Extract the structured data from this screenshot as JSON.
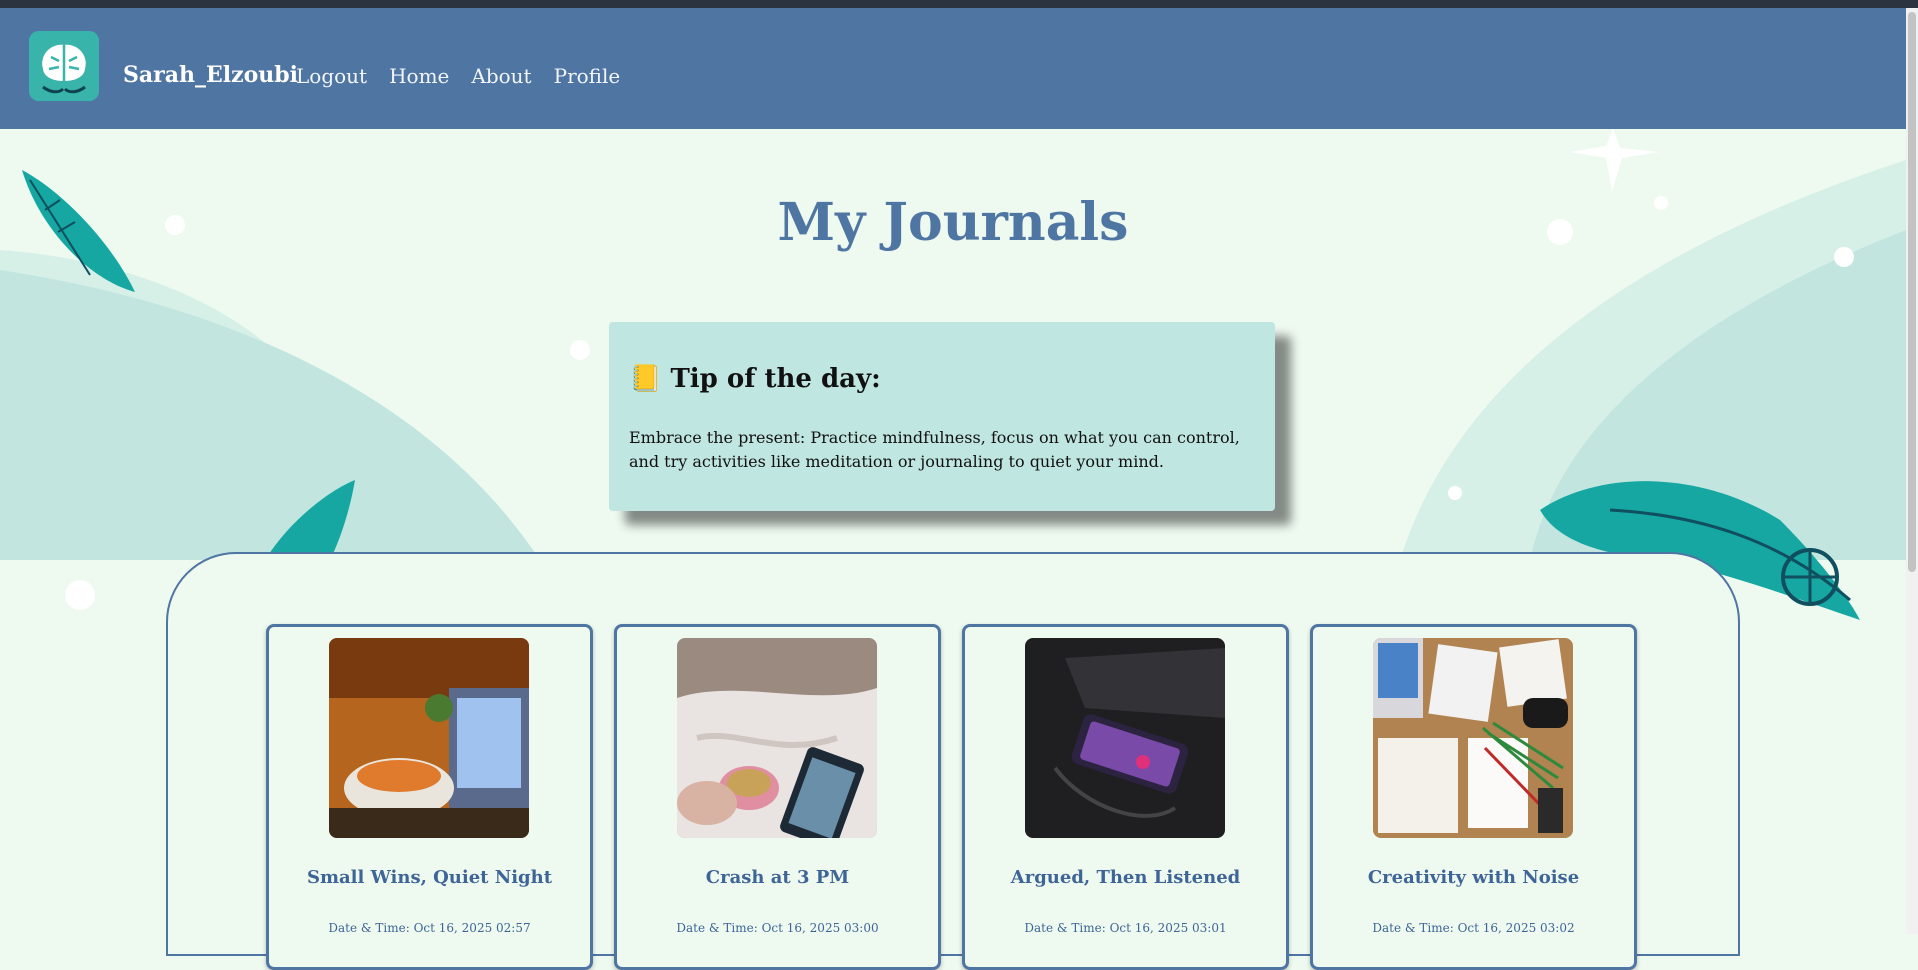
{
  "navbar": {
    "username": "Sarah_Elzoubi",
    "links": [
      "Logout",
      "Home",
      "About",
      "Profile"
    ],
    "logo_icon": "brain-icon"
  },
  "page": {
    "title": "My Journals"
  },
  "tip": {
    "icon": "notebook-icon",
    "emoji": "📒",
    "heading": "Tip of the day:",
    "text": "Embrace the present: Practice mindfulness, focus on what you can control, and try activities like meditation or journaling to quiet your mind."
  },
  "journals": [
    {
      "title": "Small Wins, Quiet Night",
      "datetime": "Date & Time: Oct 16, 2025 02:57"
    },
    {
      "title": "Crash at 3 PM",
      "datetime": "Date & Time: Oct 16, 2025 03:00"
    },
    {
      "title": "Argued, Then Listened",
      "datetime": "Date & Time: Oct 16, 2025 03:01"
    },
    {
      "title": "Creativity with Noise",
      "datetime": "Date & Time: Oct 16, 2025 03:02"
    }
  ],
  "colors": {
    "primary": "#4f75a3",
    "background": "#eefaf0",
    "tip_background": "#bfe6e0",
    "teal": "#15a8a3"
  }
}
